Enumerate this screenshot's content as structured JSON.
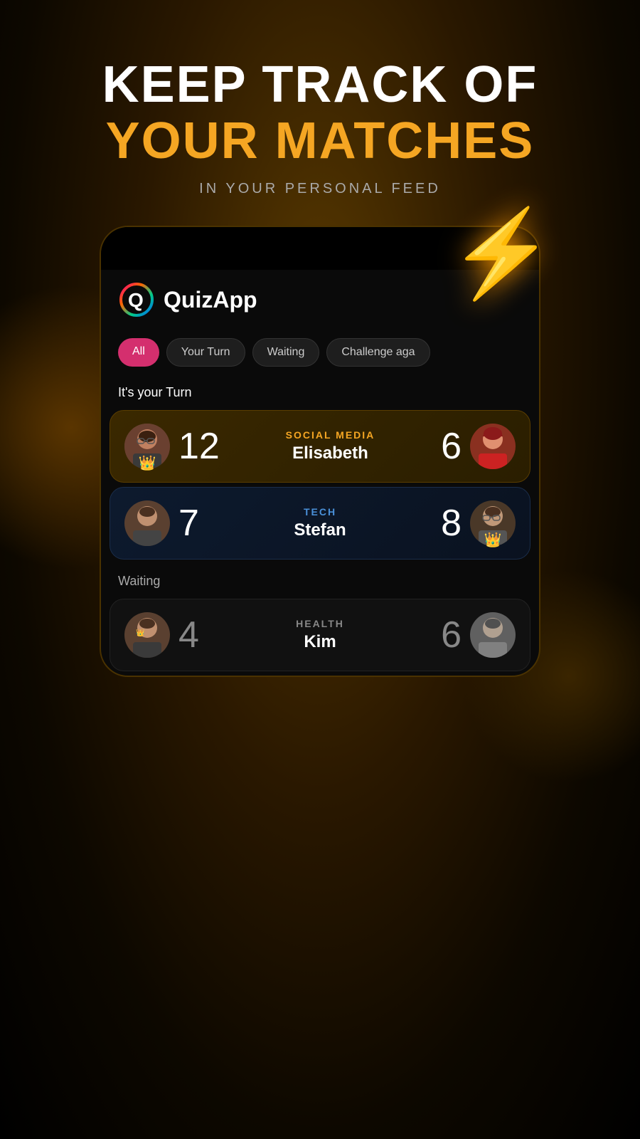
{
  "header": {
    "line1": "KEEP TRACK OF",
    "line2": "YOUR MATCHES",
    "subtitle": "IN YOUR PERSONAL FEED"
  },
  "app": {
    "name": "QuizApp"
  },
  "tabs": [
    {
      "label": "All",
      "active": true
    },
    {
      "label": "Your Turn",
      "active": false
    },
    {
      "label": "Waiting",
      "active": false
    },
    {
      "label": "Challenge aga",
      "active": false
    }
  ],
  "section_your_turn": {
    "label": "It's your Turn"
  },
  "section_waiting": {
    "label": "Waiting"
  },
  "matches": [
    {
      "category": "SOCIAL MEDIA",
      "opponent": "Elisabeth",
      "my_score": "12",
      "their_score": "6",
      "my_crown": true,
      "their_crown": false,
      "card_type": "gold"
    },
    {
      "category": "TECH",
      "opponent": "Stefan",
      "my_score": "7",
      "their_score": "8",
      "my_crown": false,
      "their_crown": true,
      "card_type": "blue"
    },
    {
      "category": "HEALTH",
      "opponent": "Kim",
      "my_score": "4",
      "their_score": "6",
      "my_crown": false,
      "their_crown": false,
      "card_type": "dark"
    }
  ],
  "lightning": "⚡"
}
